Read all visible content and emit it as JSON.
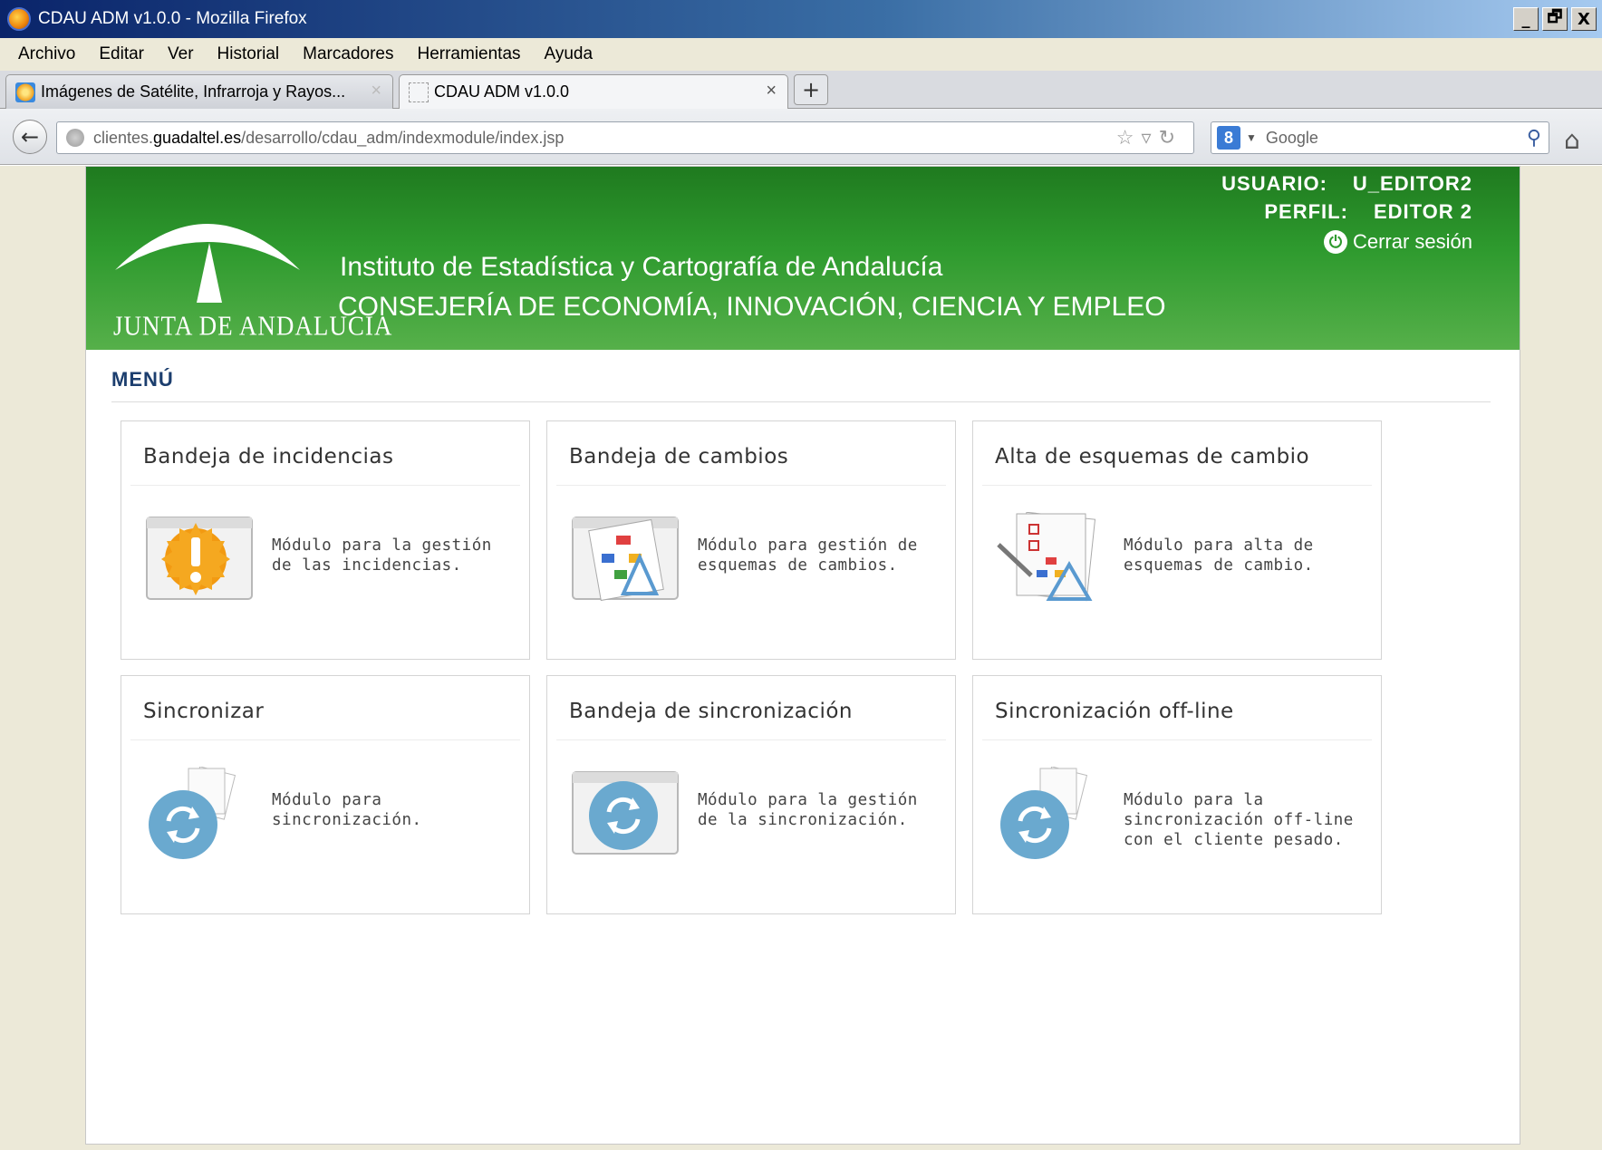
{
  "window": {
    "title": "CDAU ADM v1.0.0 - Mozilla Firefox",
    "controls": [
      "_",
      "🗗",
      "X"
    ]
  },
  "menubar": [
    "Archivo",
    "Editar",
    "Ver",
    "Historial",
    "Marcadores",
    "Herramientas",
    "Ayuda"
  ],
  "tabs": [
    {
      "label": "Imágenes de Satélite, Infrarroja y Rayos...",
      "close": "×"
    },
    {
      "label": "CDAU ADM v1.0.0",
      "close": "×"
    }
  ],
  "new_tab": "+",
  "url": {
    "prefix": "clientes.",
    "host": "guadaltel.es",
    "path": "/desarrollo/cdau_adm/indexmodule/index.jsp"
  },
  "search": {
    "engine_badge": "8",
    "placeholder": "Google"
  },
  "header": {
    "logo_text": "JUNTA DE ANDALUCIA",
    "institute": "Instituto de Estadística y Cartografía de Andalucía",
    "ministry": "CONSEJERÍA DE ECONOMÍA, INNOVACIÓN, CIENCIA Y EMPLEO",
    "user_label": "USUARIO:",
    "user_value": "U_EDITOR2",
    "profile_label": "PERFIL:",
    "profile_value": "EDITOR 2",
    "logout": "Cerrar sesión"
  },
  "menu": {
    "title": "MENÚ",
    "cards": [
      {
        "title": "Bandeja de incidencias",
        "desc": "Módulo para la gestión de las incidencias.",
        "icon": "warning-window-icon"
      },
      {
        "title": "Bandeja de cambios",
        "desc": "Módulo para gestión de esquemas de cambios.",
        "icon": "diagram-window-icon"
      },
      {
        "title": "Alta de esquemas de cambio",
        "desc": "Módulo para alta de esquemas de cambio.",
        "icon": "checklist-diagram-icon"
      },
      {
        "title": "Sincronizar",
        "desc": "Módulo para sincronización.",
        "icon": "sync-documents-icon"
      },
      {
        "title": "Bandeja de sincronización",
        "desc": "Módulo para la gestión de la sincronización.",
        "icon": "sync-window-icon"
      },
      {
        "title": "Sincronización off-line",
        "desc": "Módulo para la sincronización off-line con el cliente pesado.",
        "icon": "sync-documents-icon"
      }
    ]
  },
  "colors": {
    "header_green": "#2e9a2e",
    "menu_title": "#1c3e6e",
    "sync_blue": "#6aa9cf",
    "warning_orange": "#f29a12"
  }
}
